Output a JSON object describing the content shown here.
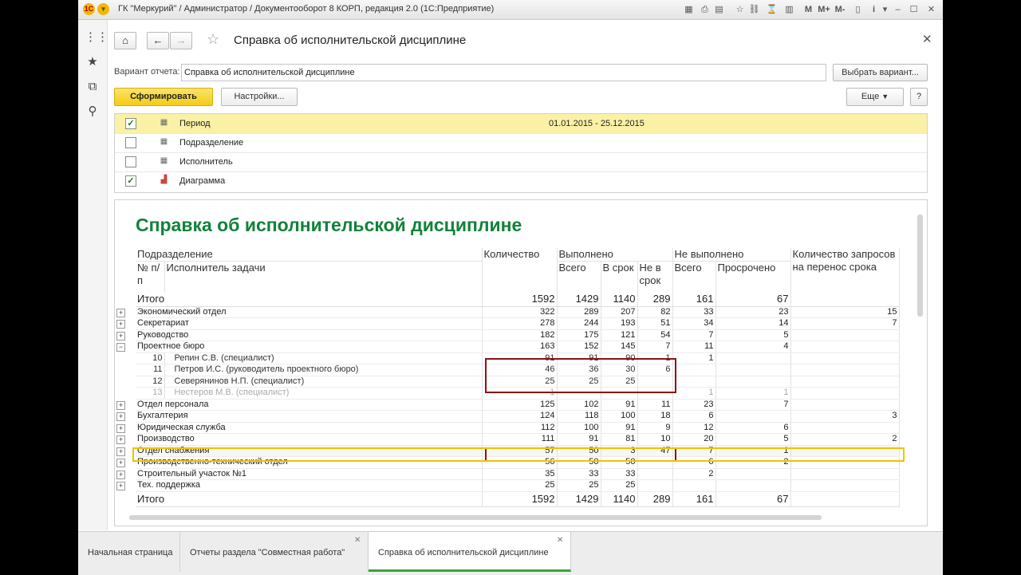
{
  "window": {
    "title": "ГК \"Меркурий\" / Администратор / Документооборот 8 КОРП, редакция 2.0  (1С:Предприятие)"
  },
  "toolbar_right": {
    "m": "M",
    "mplus": "M+",
    "mminus": "M-",
    "info": "i"
  },
  "form": {
    "title": "Справка об исполнительской дисциплине",
    "variant_label": "Вариант отчета:",
    "variant_value": "Справка об исполнительской дисциплине",
    "choose_variant": "Выбрать вариант...",
    "generate": "Сформировать",
    "settings": "Настройки...",
    "more": "Еще",
    "help": "?"
  },
  "params": [
    {
      "label": "Период",
      "checked": true,
      "value": "01.01.2015 - 25.12.2015"
    },
    {
      "label": "Подразделение",
      "checked": false,
      "value": ""
    },
    {
      "label": "Исполнитель",
      "checked": false,
      "value": ""
    },
    {
      "label": "Диаграмма",
      "checked": true,
      "value": ""
    }
  ],
  "report": {
    "title": "Справка об исполнительской дисциплине",
    "headers": {
      "dept": "Подразделение",
      "num": "№ п/п",
      "executor": "Исполнитель задачи",
      "count": "Количество",
      "done": "Выполнено",
      "done_total": "Всего",
      "done_ontime": "В срок",
      "done_late": "Не в срок",
      "notdone": "Не выполнено",
      "nd_total": "Всего",
      "nd_overdue": "Просрочено",
      "requests": "Количество запросов на перенос срока"
    },
    "total_label": "Итого",
    "totals": [
      "1592",
      "1429",
      "1140",
      "289",
      "161",
      "67",
      ""
    ],
    "rows": [
      {
        "type": "dept",
        "name": "Экономический отдел",
        "v": [
          "322",
          "289",
          "207",
          "82",
          "33",
          "23",
          "15"
        ]
      },
      {
        "type": "dept",
        "name": "Секретариат",
        "v": [
          "278",
          "244",
          "193",
          "51",
          "34",
          "14",
          "7"
        ]
      },
      {
        "type": "dept",
        "name": "Руководство",
        "v": [
          "182",
          "175",
          "121",
          "54",
          "7",
          "5",
          ""
        ]
      },
      {
        "type": "dept",
        "name": "Проектное бюро",
        "expanded": true,
        "v": [
          "163",
          "152",
          "145",
          "7",
          "11",
          "4",
          ""
        ]
      },
      {
        "type": "child",
        "no": "10",
        "name": "Репин С.В. (специалист)",
        "v": [
          "91",
          "91",
          "90",
          "1",
          "1",
          "",
          ""
        ]
      },
      {
        "type": "child",
        "no": "11",
        "name": "Петров И.С. (руководитель проектного бюро)",
        "v": [
          "46",
          "36",
          "30",
          "6",
          "",
          "",
          ""
        ]
      },
      {
        "type": "child",
        "no": "12",
        "name": "Северянинов Н.П. (специалист)",
        "v": [
          "25",
          "25",
          "25",
          "",
          "",
          "",
          ""
        ]
      },
      {
        "type": "muted",
        "no": "13",
        "name": "Нестеров М.В. (специалист)",
        "v": [
          "1",
          "",
          "",
          "",
          "1",
          "1",
          ""
        ]
      },
      {
        "type": "dept",
        "name": "Отдел персонала",
        "v": [
          "125",
          "102",
          "91",
          "11",
          "23",
          "7",
          ""
        ]
      },
      {
        "type": "dept",
        "name": "Бухгалтерия",
        "v": [
          "124",
          "118",
          "100",
          "18",
          "6",
          "",
          "3"
        ]
      },
      {
        "type": "dept",
        "name": "Юридическая служба",
        "v": [
          "112",
          "100",
          "91",
          "9",
          "12",
          "6",
          ""
        ]
      },
      {
        "type": "dept",
        "name": "Производство",
        "v": [
          "111",
          "91",
          "81",
          "10",
          "20",
          "5",
          "2"
        ]
      },
      {
        "type": "supply",
        "name": "Отдел снабжения",
        "v": [
          "57",
          "50",
          "3",
          "47",
          "7",
          "1",
          ""
        ]
      },
      {
        "type": "dept",
        "name": "Производственно-технический отдел",
        "v": [
          "56",
          "50",
          "50",
          "",
          "6",
          "2",
          ""
        ]
      },
      {
        "type": "dept",
        "name": "Строительный участок №1",
        "v": [
          "35",
          "33",
          "33",
          "",
          "2",
          "",
          ""
        ]
      },
      {
        "type": "dept",
        "name": "Тех. поддержка",
        "v": [
          "25",
          "25",
          "25",
          "",
          "",
          "",
          ""
        ]
      }
    ]
  },
  "tabs": [
    {
      "label": "Начальная страница",
      "active": false
    },
    {
      "label": "Отчеты раздела \"Совместная работа\"",
      "active": false
    },
    {
      "label": "Справка об исполнительской дисциплине",
      "active": true
    }
  ],
  "icons": {
    "home": "home-icon",
    "back": "arrow-left-icon",
    "forward": "arrow-right-icon",
    "star": "star-icon",
    "close": "close-icon",
    "menu": "apps-grid-icon",
    "favorites": "star-icon",
    "history": "history-icon",
    "search": "search-icon"
  }
}
